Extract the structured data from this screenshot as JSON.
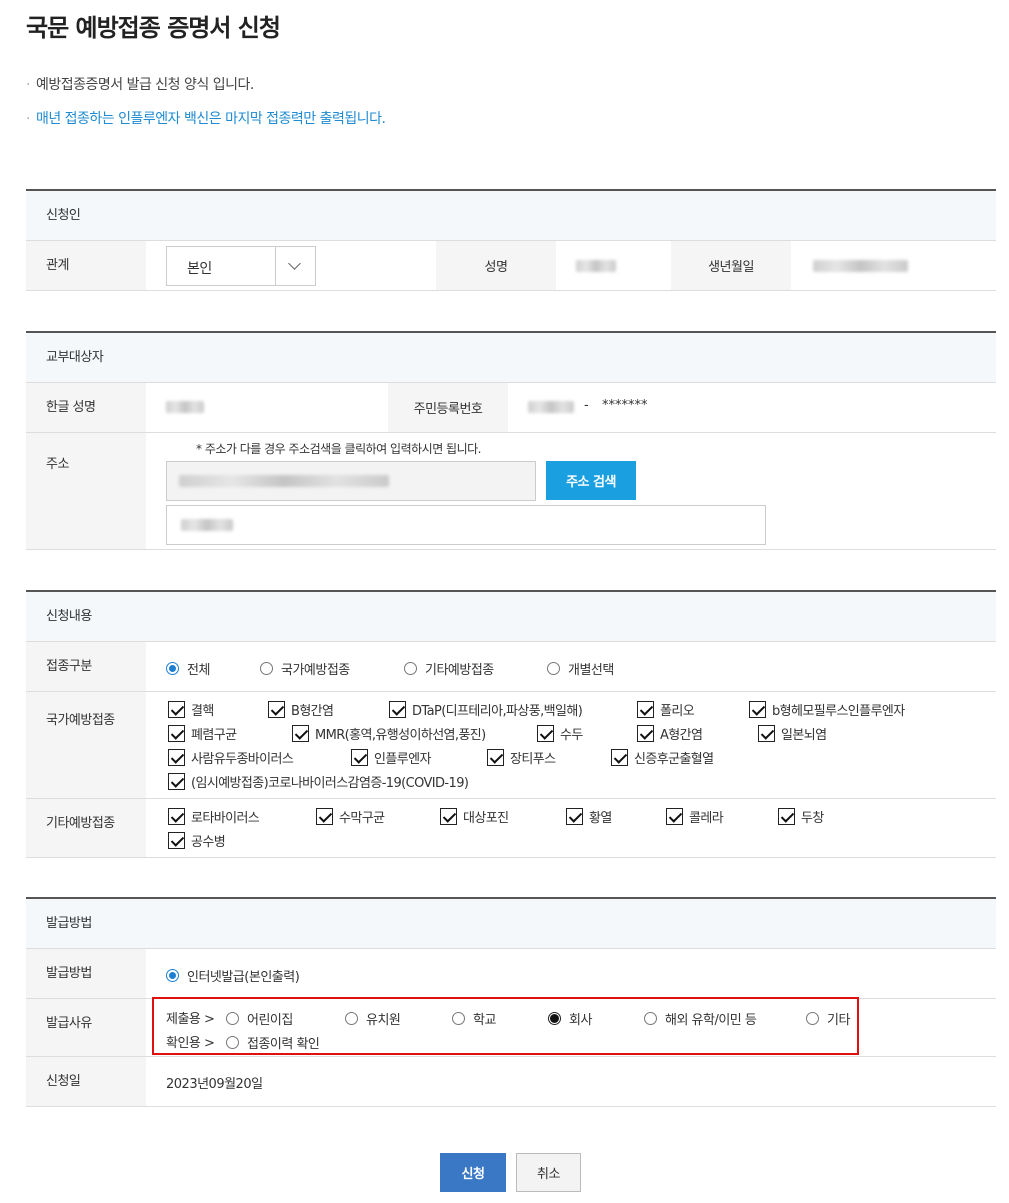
{
  "page": {
    "title": "국문 예방접종 증명서 신청",
    "notice1": "예방접종증명서 발급 신청 양식 입니다.",
    "notice2": "매년 접종하는 인플루엔자 백신은 마지막 접종력만 출력됩니다."
  },
  "applicant": {
    "header": "신청인",
    "relation_label": "관계",
    "relation_value": "본인",
    "name_label": "성명",
    "birth_label": "생년월일"
  },
  "recipient": {
    "header": "교부대상자",
    "name_label": "한글 성명",
    "rrn_label": "주민등록번호",
    "rrn_dash": "-",
    "rrn_masked": "*******",
    "address_label": "주소",
    "address_note": "* 주소가 다를 경우 주소검색을 클릭하여 입력하시면 됩니다.",
    "address_search_button": "주소 검색"
  },
  "request": {
    "header": "신청내용",
    "type_label": "접종구분",
    "type_options": [
      "전체",
      "국가예방접종",
      "기타예방접종",
      "개별선택"
    ],
    "type_selected": "전체",
    "national_label": "국가예방접종",
    "national_items": [
      "결핵",
      "B형간염",
      "DTaP(디프테리아,파상풍,백일해)",
      "폴리오",
      "b형헤모필루스인플루엔자",
      "폐렴구균",
      "MMR(홍역,유행성이하선염,풍진)",
      "수두",
      "A형간염",
      "일본뇌염",
      "사람유두종바이러스",
      "인플루엔자",
      "장티푸스",
      "신증후군출혈열",
      "(임시예방접종)코로나바이러스감염증-19(COVID-19)"
    ],
    "other_label": "기타예방접종",
    "other_items": [
      "로타바이러스",
      "수막구균",
      "대상포진",
      "황열",
      "콜레라",
      "두창",
      "공수병"
    ]
  },
  "issue": {
    "header": "발급방법",
    "method_label": "발급방법",
    "method_value": "인터넷발급(본인출력)",
    "reason_label": "발급사유",
    "submit_prefix": "제출용 >",
    "submit_options": [
      "어린이집",
      "유치원",
      "학교",
      "회사",
      "해외 유학/이민 등",
      "기타"
    ],
    "submit_selected": "회사",
    "confirm_prefix": "확인용 >",
    "confirm_option": "접종이력 확인",
    "date_label": "신청일",
    "date_value": "2023년09월20일"
  },
  "actions": {
    "submit": "신청",
    "cancel": "취소"
  }
}
